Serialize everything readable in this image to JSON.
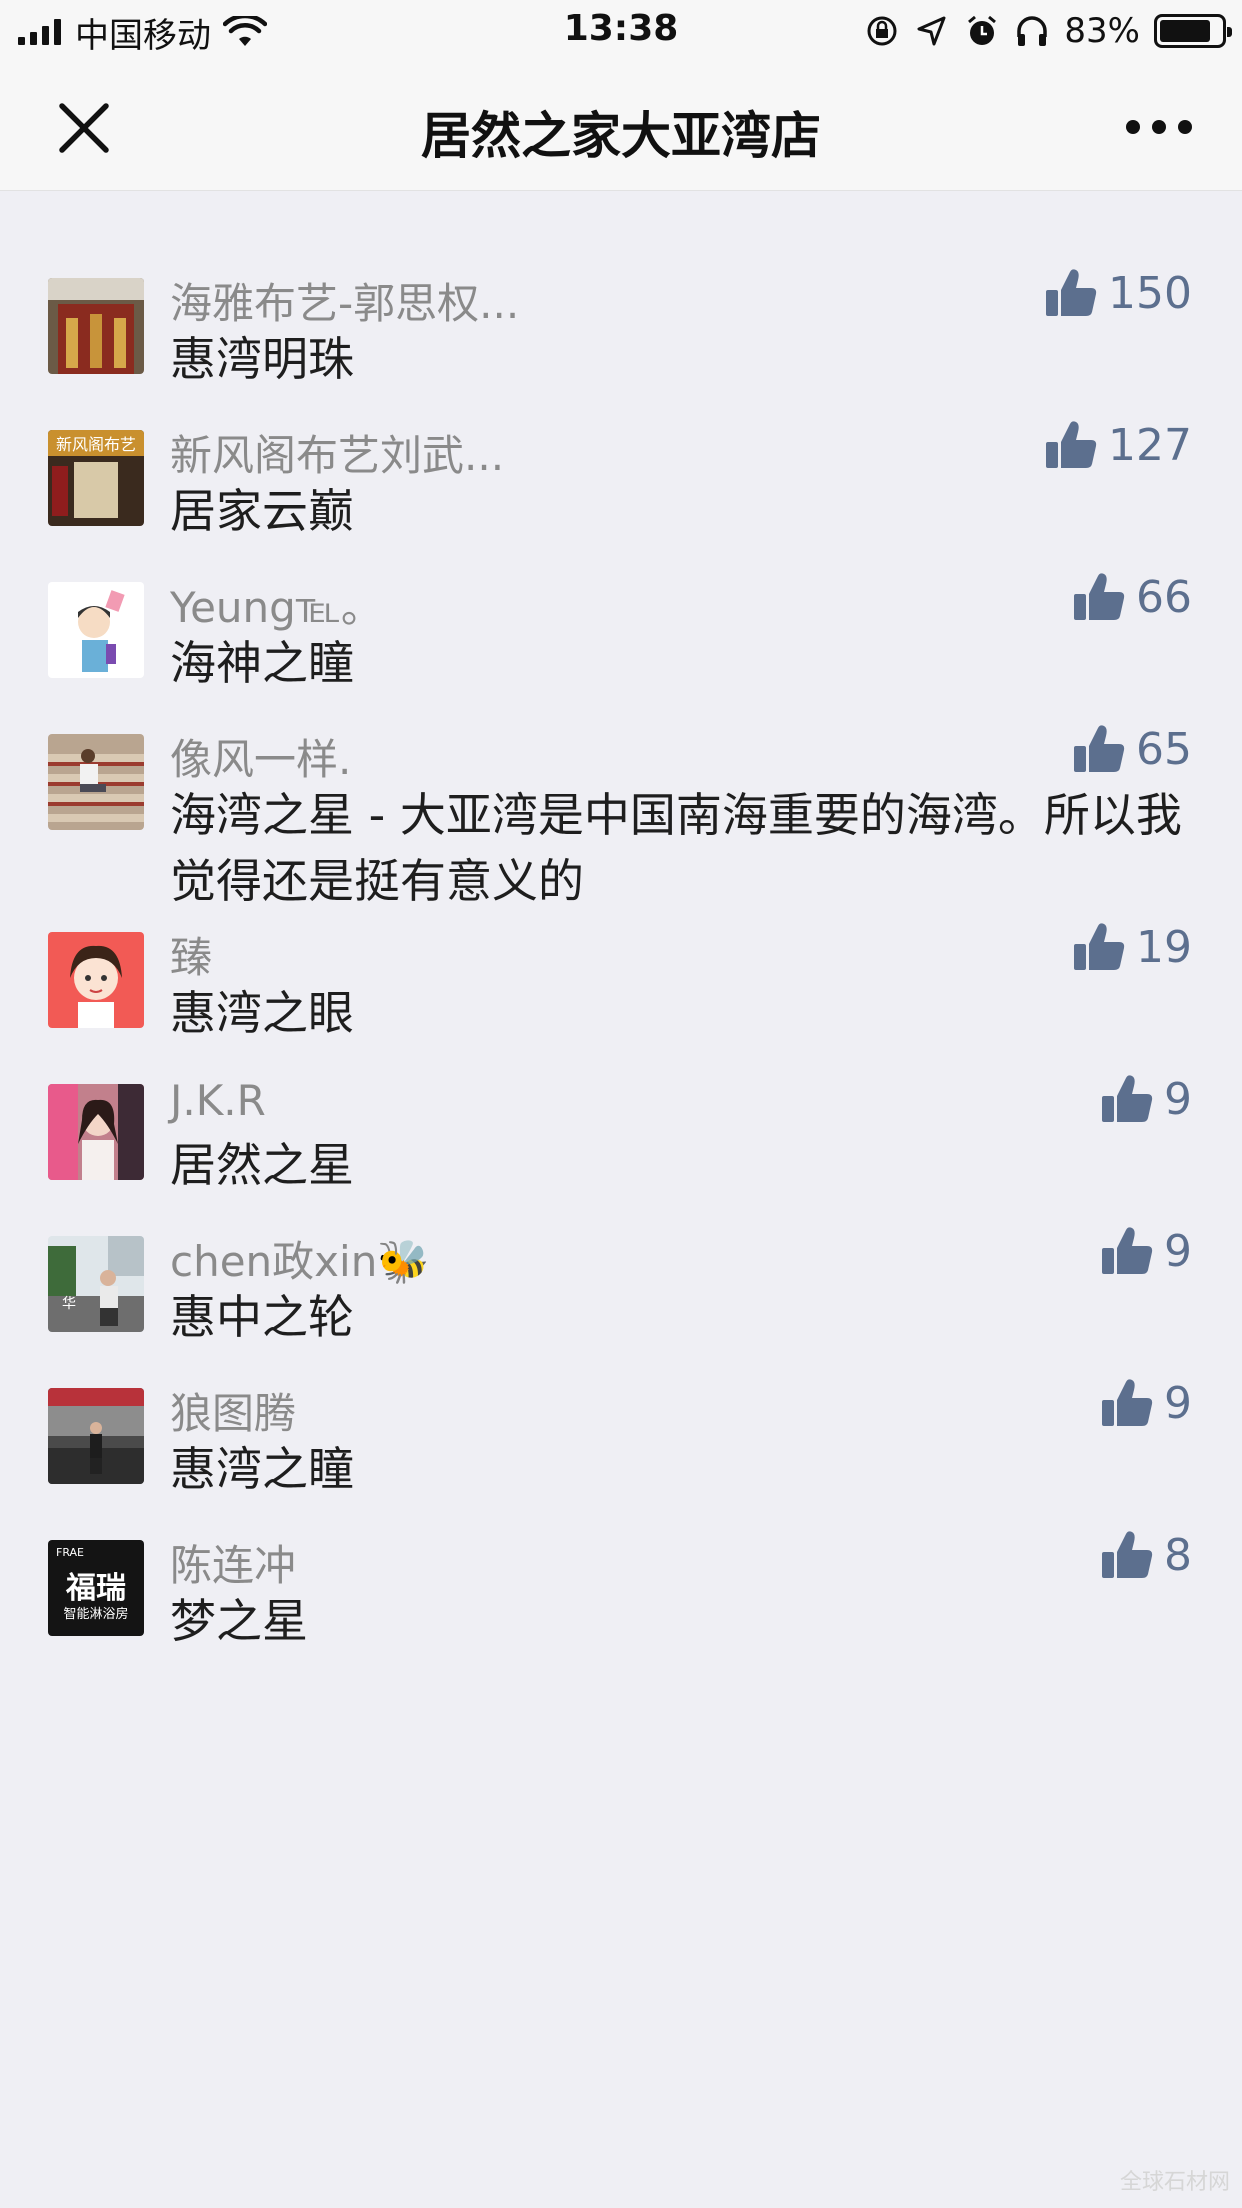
{
  "status_bar": {
    "carrier": "中国移动",
    "time": "13:38",
    "battery_percent": "83%",
    "battery_level": 0.83
  },
  "nav": {
    "title": "居然之家大亚湾店"
  },
  "colors": {
    "like_accent": "#5c6f8e",
    "background": "#efeff4"
  },
  "comments": [
    {
      "name": "海雅布艺-郭思权...",
      "text": "惠湾明珠",
      "likes": "150",
      "avatar": "store-photo-avatar"
    },
    {
      "name": "新风阁布艺刘武...",
      "text": "居家云巅",
      "likes": "127",
      "avatar": "storefront-sign-avatar"
    },
    {
      "name": "Yeung℡。",
      "text": "海神之瞳",
      "likes": "66",
      "avatar": "cartoon-boy-avatar"
    },
    {
      "name": "像风一样.",
      "text": "海湾之星 - 大亚湾是中国南海重要的海湾。所以我觉得还是挺有意义的",
      "likes": "65",
      "avatar": "stairs-photo-avatar"
    },
    {
      "name": "臻",
      "text": "惠湾之眼",
      "likes": "19",
      "avatar": "cartoon-girl-avatar"
    },
    {
      "name": "J.K.R",
      "text": "居然之星",
      "likes": "9",
      "avatar": "girl-photo-avatar"
    },
    {
      "name": "chen政xin🐝",
      "text": "惠中之轮",
      "likes": "9",
      "avatar": "street-photo-avatar"
    },
    {
      "name": "狼图腾",
      "text": "惠湾之瞳",
      "likes": "9",
      "avatar": "mall-photo-avatar"
    },
    {
      "name": "陈连冲",
      "text": "梦之星",
      "likes": "8",
      "avatar": "brand-logo-avatar",
      "avatar_text": {
        "top": "FRAE",
        "main": "福瑞",
        "sub": "智能淋浴房"
      }
    }
  ],
  "watermark": "全球石材网"
}
